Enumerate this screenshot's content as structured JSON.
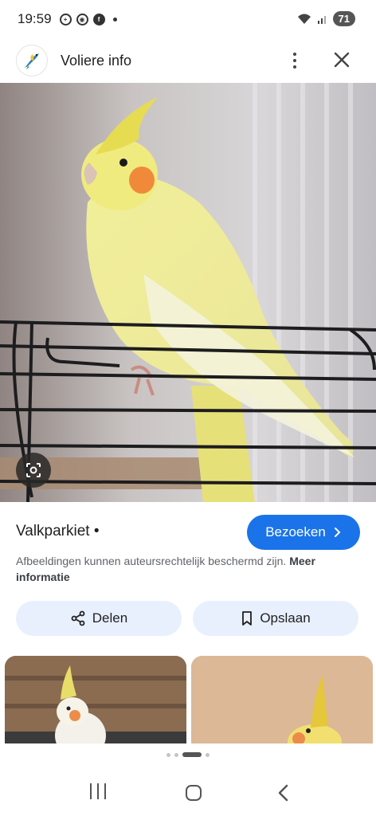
{
  "status_bar": {
    "time": "19:59",
    "battery": "71",
    "notification_icons": [
      "plus-circle-icon",
      "chrome-icon",
      "facebook-icon",
      "more-dot-icon"
    ]
  },
  "header": {
    "title": "Voliere info",
    "more_icon": "more-vertical-icon",
    "close_icon": "close-icon"
  },
  "main_image": {
    "subject": "yellow cockatiel perched on cage",
    "lens_icon": "lens-search-icon"
  },
  "info": {
    "title": "Valkparkiet •",
    "visit_label": "Bezoeken",
    "copyright_text": "Afbeeldingen kunnen auteursrechtelijk beschermd zijn.",
    "more_info_label": "Meer informatie"
  },
  "actions": {
    "share_label": "Delen",
    "save_label": "Opslaan"
  },
  "colors": {
    "accent": "#1a73e8",
    "action_bg": "#e8f0fe"
  }
}
